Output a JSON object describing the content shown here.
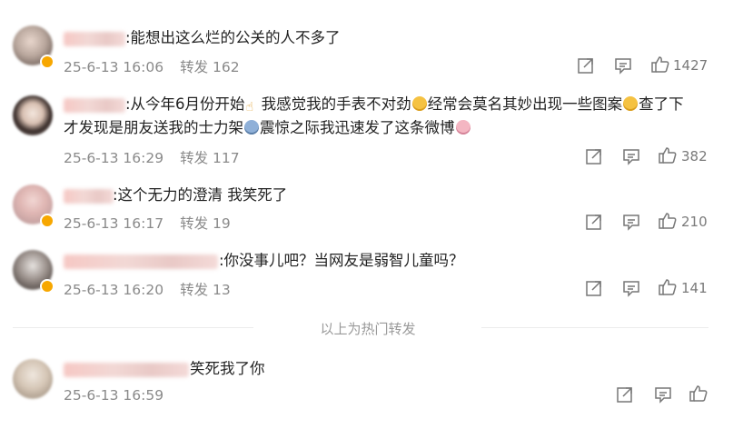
{
  "divider_text": "以上为热门转发",
  "comments": [
    {
      "text": ":能想出这么烂的公关的人不多了",
      "time": "25-6-13 16:06",
      "repost": "转发 162",
      "likes": "1427"
    },
    {
      "text_line1_a": ":从今年6月份开始",
      "text_line1_b": "我感觉我的手表不对劲",
      "text_line1_c": "经常会莫名其妙出现一些图案",
      "text_line1_d": "查了下",
      "text_line2_a": "才发现是朋友送我的士力架",
      "text_line2_b": "震惊之际我迅速发了这条微博",
      "time": "25-6-13 16:29",
      "repost": "转发 117",
      "likes": "382"
    },
    {
      "text": ":这个无力的澄清 我笑死了",
      "time": "25-6-13 16:17",
      "repost": "转发 19",
      "likes": "210"
    },
    {
      "text": ":你没事儿吧？当网友是弱智儿童吗？",
      "time": "25-6-13 16:20",
      "repost": "转发 13",
      "likes": "141"
    },
    {
      "text": "笑死我了你",
      "time": "25-6-13 16:59",
      "repost": "",
      "likes": ""
    }
  ],
  "icons": {
    "share": "share-icon",
    "comment": "comment-icon",
    "like": "thumbs-up-icon"
  },
  "colors": {
    "badge": "#f7a700",
    "meta": "#8a8a8a",
    "text": "#222222"
  }
}
